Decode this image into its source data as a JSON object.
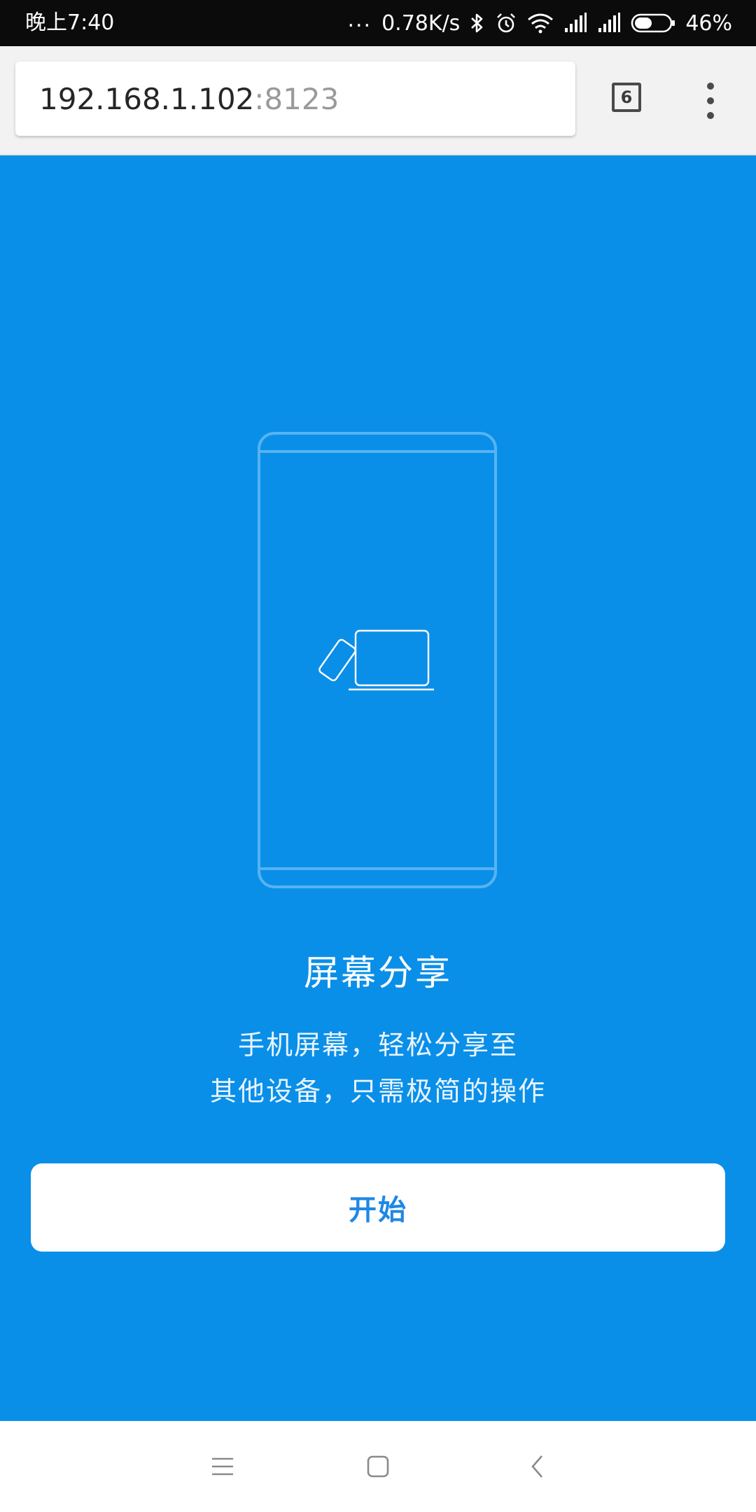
{
  "status_bar": {
    "time": "晚上7:40",
    "dots": "...",
    "net_speed": "0.78K/s",
    "battery": "46%",
    "icons": [
      "bluetooth-icon",
      "alarm-icon",
      "wifi-icon",
      "signal-icon",
      "signal-icon",
      "battery-icon"
    ]
  },
  "toolbar": {
    "url_host": "192.168.1.102",
    "url_port": ":8123",
    "tab_count": "6",
    "menu_icon": "more-vert-icon"
  },
  "main": {
    "illustration": "phone-with-screen-share-icon",
    "title": "屏幕分享",
    "desc_line1": "手机屏幕，轻松分享至",
    "desc_line2": "其他设备，只需极简的操作",
    "start_button": "开始"
  },
  "nav_bar": {
    "icons": [
      "menu-icon",
      "home-icon",
      "back-icon"
    ]
  },
  "colors": {
    "background": "#0a8fe8",
    "button_text": "#1e88e5",
    "status_bar": "#0b0b0b"
  }
}
